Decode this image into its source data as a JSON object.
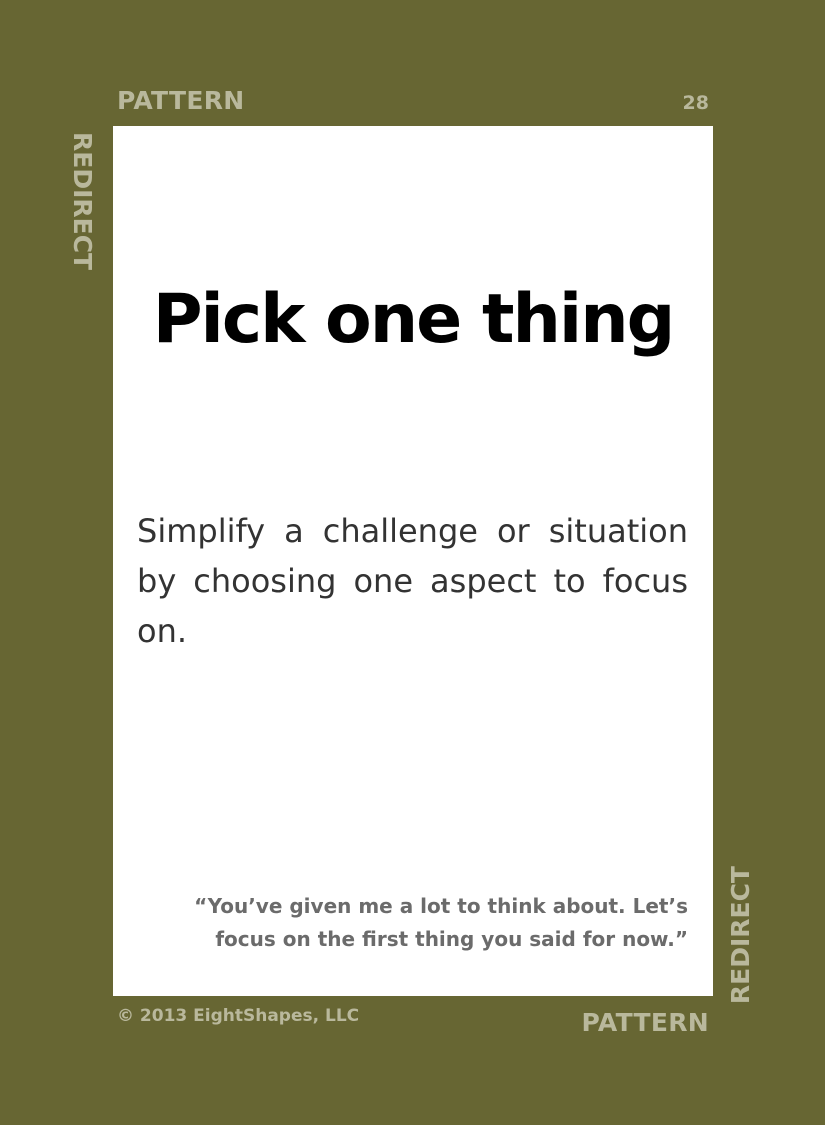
{
  "card": {
    "pattern_label_top": "PATTERN",
    "pattern_label_bottom": "PATTERN",
    "category_label_left": "REDIRECT",
    "category_label_right": "REDIRECT",
    "number": "28",
    "title": "Pick one thing",
    "description": "Simplify a challenge or situation by choosing one aspect to focus on.",
    "quote": "“You’ve given me a lot to think about. Let’s focus on the first thing you said for now.”",
    "copyright": "© 2013 EightShapes, LLC"
  },
  "colors": {
    "border": "#676633",
    "border_text": "#b9b89c",
    "panel": "#ffffff",
    "title": "#000000",
    "body_text": "#333333",
    "quote_text": "#6b6b6b"
  }
}
